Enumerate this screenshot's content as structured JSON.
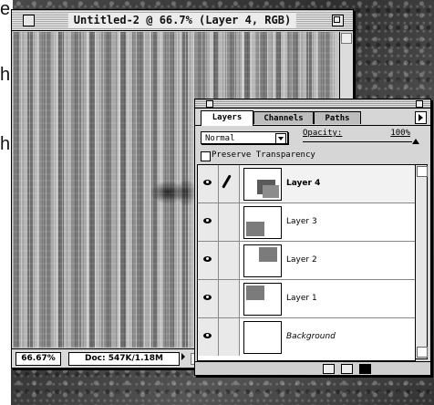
{
  "document": {
    "title": "Untitled-2 @ 66.7% (Layer 4, RGB)",
    "zoom": "66.67%",
    "doc_size": "Doc: 547K/1.18M"
  },
  "stray_text": [
    "e",
    "h",
    "h"
  ],
  "layers_palette": {
    "tabs": [
      {
        "label": "Layers",
        "active": true
      },
      {
        "label": "Channels",
        "active": false
      },
      {
        "label": "Paths",
        "active": false
      }
    ],
    "blend_mode": "Normal",
    "opacity_label": "Opacity:",
    "opacity_value": "100%",
    "preserve_transparency_label": "Preserve Transparency",
    "preserve_transparency_checked": false,
    "layers": [
      {
        "name": "Layer 4",
        "visible": true,
        "selected": true,
        "style": "bold"
      },
      {
        "name": "Layer 3",
        "visible": true,
        "selected": false,
        "style": "normal"
      },
      {
        "name": "Layer 2",
        "visible": true,
        "selected": false,
        "style": "normal"
      },
      {
        "name": "Layer 1",
        "visible": true,
        "selected": false,
        "style": "normal"
      },
      {
        "name": "Background",
        "visible": true,
        "selected": false,
        "style": "italic"
      }
    ],
    "bottom_icons": [
      "mask-icon",
      "new-layer-icon",
      "trash-icon"
    ]
  }
}
